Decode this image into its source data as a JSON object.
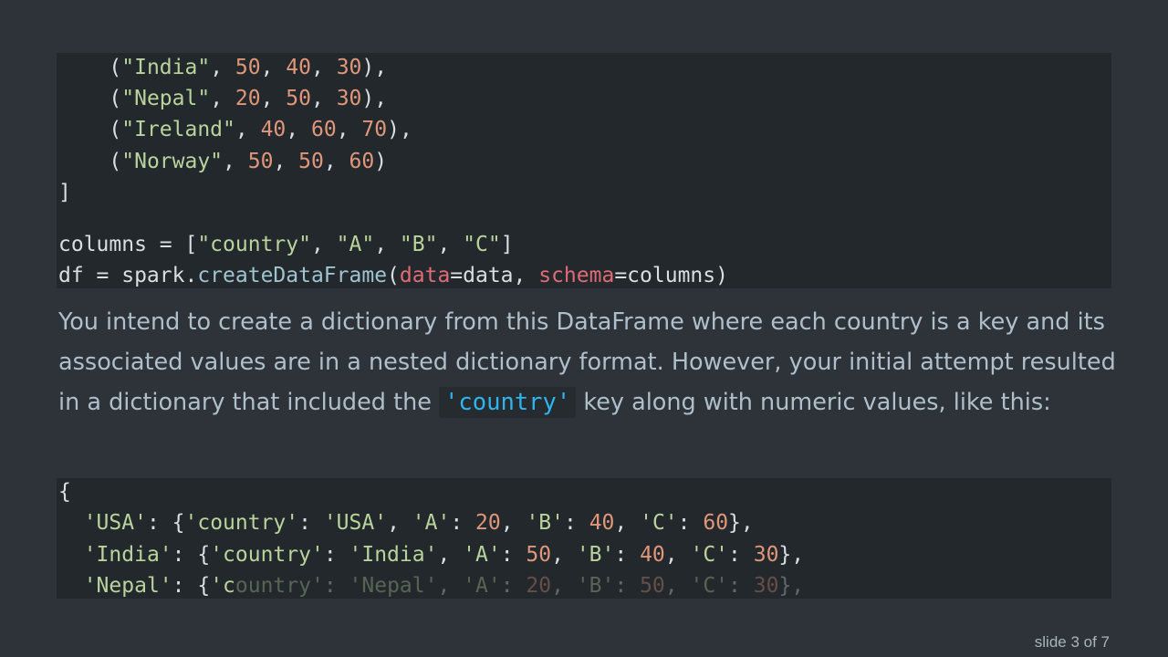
{
  "code_top": {
    "line1": {
      "a": "    (",
      "b": "\"India\"",
      "c": ", ",
      "d": "50",
      "e": ", ",
      "f": "40",
      "g": ", ",
      "h": "30",
      "i": "),"
    },
    "line2": {
      "a": "    (",
      "b": "\"Nepal\"",
      "c": ", ",
      "d": "20",
      "e": ", ",
      "f": "50",
      "g": ", ",
      "h": "30",
      "i": "),"
    },
    "line3": {
      "a": "    (",
      "b": "\"Ireland\"",
      "c": ", ",
      "d": "40",
      "e": ", ",
      "f": "60",
      "g": ", ",
      "h": "70",
      "i": "),"
    },
    "line4": {
      "a": "    (",
      "b": "\"Norway\"",
      "c": ", ",
      "d": "50",
      "e": ", ",
      "f": "50",
      "g": ", ",
      "h": "60",
      "i": ")"
    },
    "line5": "]",
    "line6": {
      "a": "columns = [",
      "b": "\"country\"",
      "c": ", ",
      "d": "\"A\"",
      "e": ", ",
      "f": "\"B\"",
      "g": ", ",
      "h": "\"C\"",
      "i": "]"
    },
    "line7": {
      "a": "df = spark.",
      "b": "createDataFrame",
      "c": "(",
      "d": "data",
      "e": "=data, ",
      "f": "schema",
      "g": "=columns)"
    }
  },
  "prose": {
    "before": "You intend to create a dictionary from this DataFrame where each country is a key and its associated values are in a nested dictionary format. However, your initial attempt resulted in a dictionary that included the ",
    "code": "'country'",
    "after": " key along with numeric values, like this:"
  },
  "code_bottom": {
    "line1": "{",
    "line2": {
      "a": "  ",
      "b": "'USA'",
      "c": ": {",
      "d": "'country'",
      "e": ": ",
      "f": "'USA'",
      "g": ", ",
      "h": "'A'",
      "i": ": ",
      "j": "20",
      "k": ", ",
      "l": "'B'",
      "m": ": ",
      "n": "40",
      "o": ", ",
      "p": "'C'",
      "q": ": ",
      "r": "60",
      "s": "},"
    },
    "line3": {
      "a": "  ",
      "b": "'India'",
      "c": ": {",
      "d": "'country'",
      "e": ": ",
      "f": "'India'",
      "g": ", ",
      "h": "'A'",
      "i": ": ",
      "j": "50",
      "k": ", ",
      "l": "'B'",
      "m": ": ",
      "n": "40",
      "o": ", ",
      "p": "'C'",
      "q": ": ",
      "r": "30",
      "s": "},"
    },
    "line4": {
      "a": "  ",
      "b": "'Nepal'",
      "c": ": {",
      "d": "'c",
      "e": "ountry'",
      "f": ": ",
      "g": "'Nepal'",
      "h": ", ",
      "i": "'A'",
      "j": ": ",
      "k": "20",
      "l": ", ",
      "m": "'B'",
      "n": ": ",
      "o": "50",
      "p": ", ",
      "q": "'C'",
      "r": ": ",
      "s": "30",
      "t": "},"
    }
  },
  "footer": {
    "slide_label": "slide 3 of 7"
  }
}
